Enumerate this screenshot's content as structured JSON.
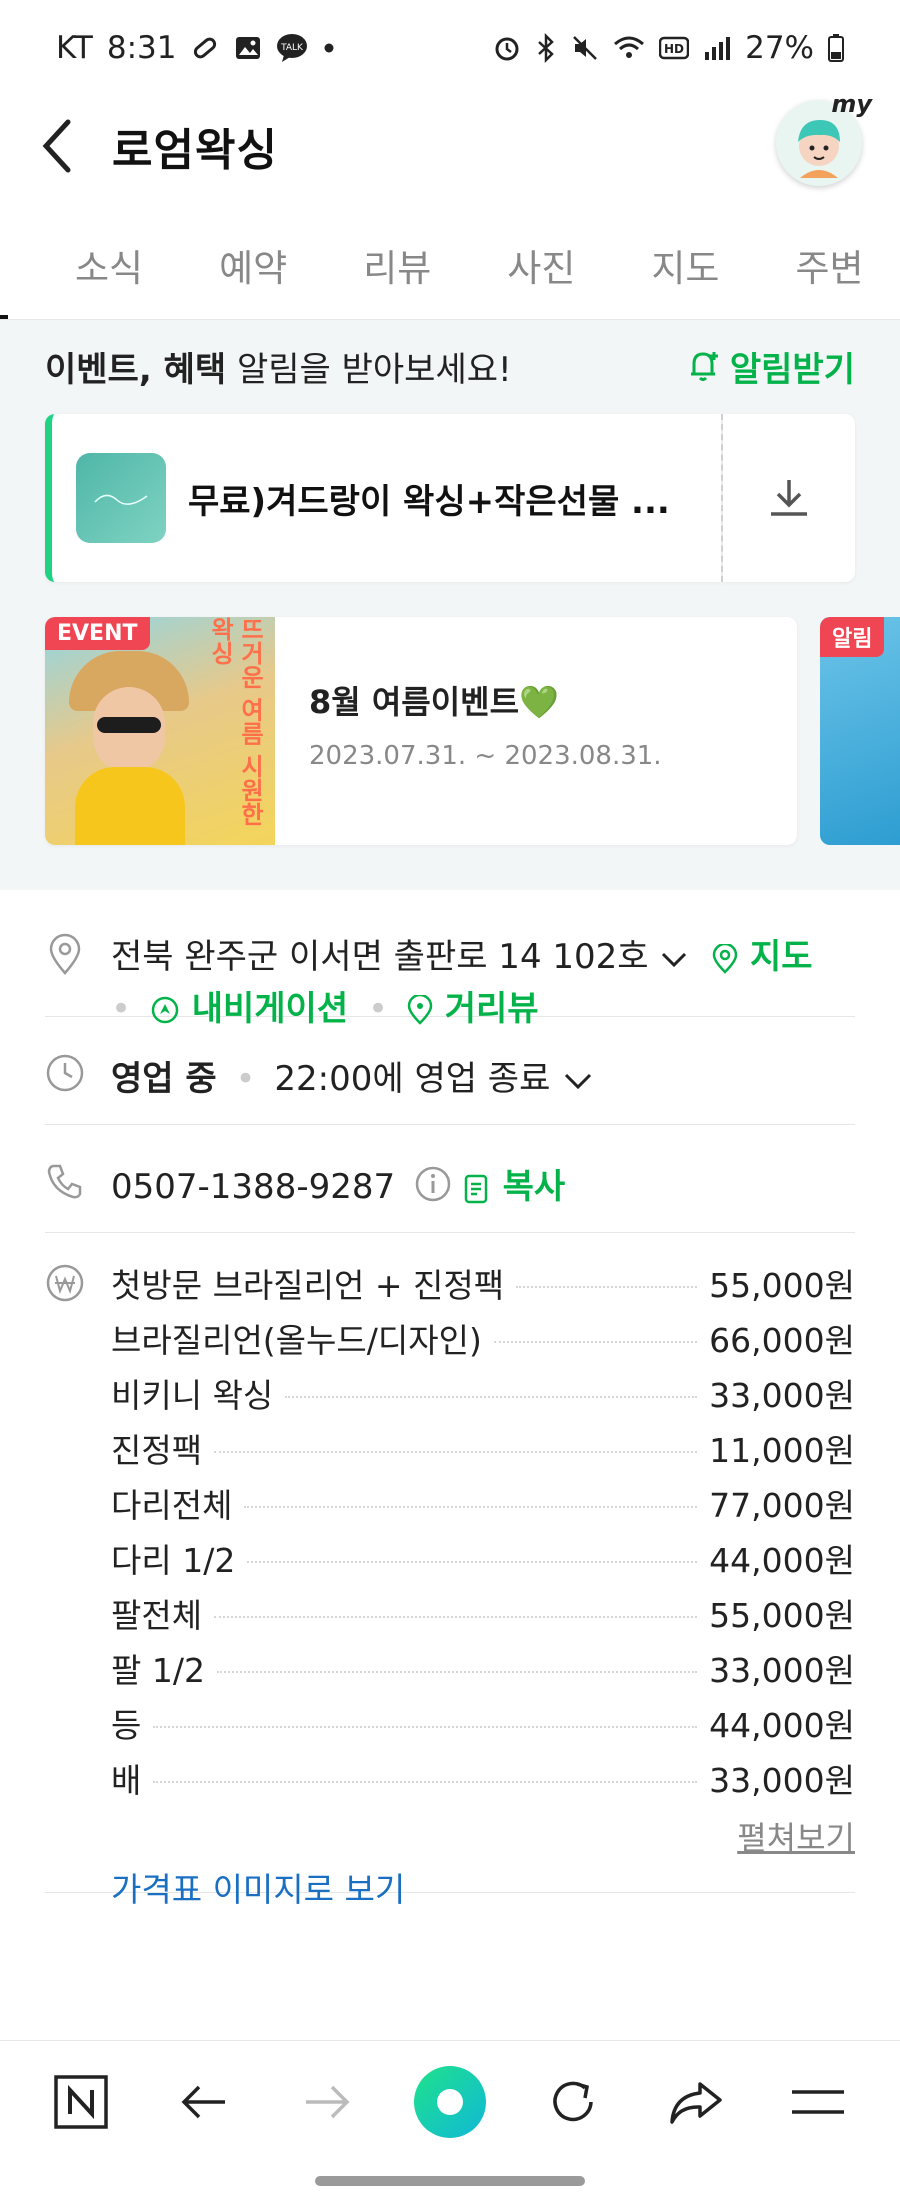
{
  "status_bar": {
    "carrier": "KT",
    "time": "8:31",
    "battery": "27%"
  },
  "header": {
    "title": "로엄왁싱",
    "avatar_label": "my"
  },
  "tabs": [
    "소식",
    "예약",
    "리뷰",
    "사진",
    "지도",
    "주변"
  ],
  "alert": {
    "text_bold": "이벤트, 혜택",
    "text_rest": " 알림을 받아보세요!",
    "button": "알림받기"
  },
  "coupon": {
    "title": "무료)겨드랑이 왁싱+작은선물 ..."
  },
  "event": {
    "badge": "EVENT",
    "title": "8월 여름이벤트💚",
    "date": "2023.07.31. ~ 2023.08.31.",
    "image_text": "뜨거운 여름 시원한 왁싱"
  },
  "event2": {
    "badge": "알림"
  },
  "address": {
    "text": "전북 완주군 이서면 출판로 14 102호",
    "map": "지도",
    "navigation": "내비게이션",
    "street_view": "거리뷰"
  },
  "hours": {
    "status": "영업 중",
    "detail": "22:00에 영업 종료"
  },
  "phone": {
    "number": "0507-1388-9287",
    "copy": "복사"
  },
  "prices": [
    {
      "name": "첫방문 브라질리언 + 진정팩",
      "price": "55,000원"
    },
    {
      "name": "브라질리언(올누드/디자인)",
      "price": "66,000원"
    },
    {
      "name": "비키니 왁싱",
      "price": "33,000원"
    },
    {
      "name": "진정팩",
      "price": "11,000원"
    },
    {
      "name": "다리전체",
      "price": "77,000원"
    },
    {
      "name": "다리 1/2",
      "price": "44,000원"
    },
    {
      "name": "팔전체",
      "price": "55,000원"
    },
    {
      "name": "팔 1/2",
      "price": "33,000원"
    },
    {
      "name": "등",
      "price": "44,000원"
    },
    {
      "name": "배",
      "price": "33,000원"
    }
  ],
  "price_more": "펼쳐보기",
  "price_image_link": "가격표 이미지로 보기",
  "colors": {
    "accent_green": "#03b34a",
    "link_blue": "#1a6fc2",
    "event_red": "#f04654"
  }
}
